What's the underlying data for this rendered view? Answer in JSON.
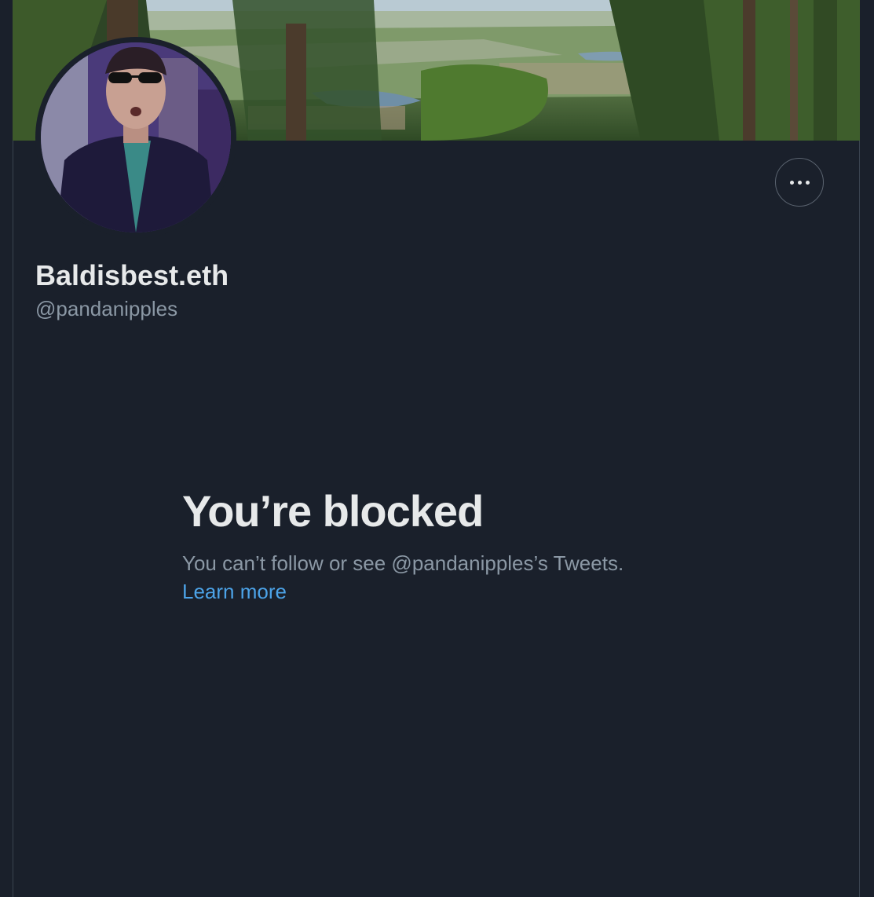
{
  "profile": {
    "display_name": "Baldisbest.eth",
    "handle": "@pandanipples",
    "banner_image": "landscape-banner",
    "avatar_image": "profile-avatar"
  },
  "actions": {
    "more_icon": "more-horizontal-icon"
  },
  "blocked": {
    "title": "You’re blocked",
    "description": "You can’t follow or see @pandanipples’s Tweets.",
    "link_label": "Learn more"
  },
  "colors": {
    "background": "#1a202b",
    "primary_text": "#e7e9ea",
    "secondary_text": "#8b98a5",
    "link": "#4ca3e8"
  }
}
